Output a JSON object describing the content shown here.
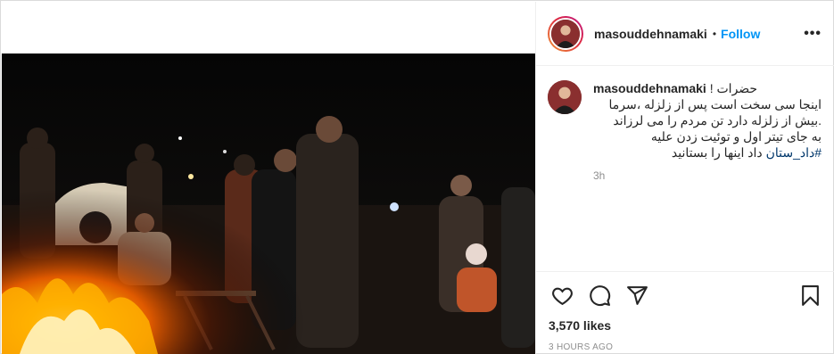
{
  "post": {
    "username": "masouddehnamaki",
    "separator": "•",
    "follow_label": "Follow",
    "more_icon": "more-horizontal-icon",
    "caption_username": "masouddehnamaki",
    "caption_lines": [
      "حضرات !",
      "اینجا سی سخت است پس از زلزله ،سرما",
      ".بیش از زلزله دارد تن مردم را می لرزاند",
      "به جای تیتر اول و توئیت زدن علیه"
    ],
    "caption_hashtag": "#داد_ستان",
    "caption_last": "داد اینها را بستانید",
    "time_ago": "3h",
    "likes": "3,570 likes",
    "posted": "3 HOURS AGO"
  },
  "icons": {
    "like": "heart-icon",
    "comment": "comment-icon",
    "share": "share-icon",
    "save": "bookmark-icon"
  },
  "colors": {
    "accent": "#0095f6",
    "text": "#262626",
    "muted": "#8e8e8e",
    "hashtag": "#00376b"
  }
}
